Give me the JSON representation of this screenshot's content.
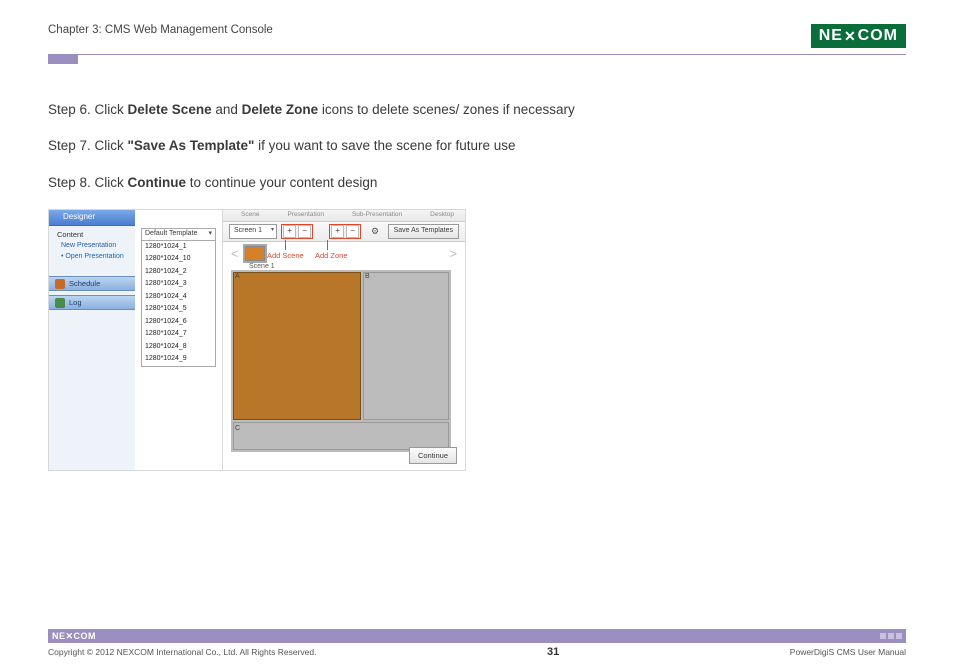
{
  "header": {
    "chapter": "Chapter 3: CMS Web Management Console",
    "logo_left": "NE",
    "logo_x": "✕",
    "logo_right": "COM"
  },
  "steps": {
    "s6_a": "Step 6. Click ",
    "s6_b1": "Delete Scene",
    "s6_mid": " and ",
    "s6_b2": "Delete Zone",
    "s6_c": " icons to delete scenes/ zones if necessary",
    "s7_a": "Step 7. Click ",
    "s7_b": "\"Save As Template\"",
    "s7_c": " if you want to save the scene for future use",
    "s8_a": "Step 8. Click ",
    "s8_b": "Continue",
    "s8_c": " to continue your content design"
  },
  "ss": {
    "designer": "Designer",
    "content": "Content",
    "new_pres": "New Presentation",
    "open_pres": "• Open Presentation",
    "schedule": "Schedule",
    "log": "Log",
    "tpl_selected": "Default Template",
    "tpl_list": [
      "1280*1024_1",
      "1280*1024_10",
      "1280*1024_2",
      "1280*1024_3",
      "1280*1024_4",
      "1280*1024_5",
      "1280*1024_6",
      "1280*1024_7",
      "1280*1024_8",
      "1280*1024_9"
    ],
    "tabs": [
      "Scene",
      "Presentation",
      "Sub-Presentation",
      "Desktop"
    ],
    "screen_sel": "Screen 1",
    "plus": "+",
    "minus": "−",
    "add_scene_anno": "Add Scene",
    "add_zone_anno": "Add Zone",
    "save_template": "Save As Templates",
    "scene1": "Scene 1",
    "continue": "Continue",
    "zA": "A",
    "zB": "B",
    "zC": "C"
  },
  "footer": {
    "logo": "NE✕COM",
    "copyright": "Copyright © 2012 NEXCOM International Co., Ltd. All Rights Reserved.",
    "page": "31",
    "manual": "PowerDigiS CMS User Manual"
  }
}
